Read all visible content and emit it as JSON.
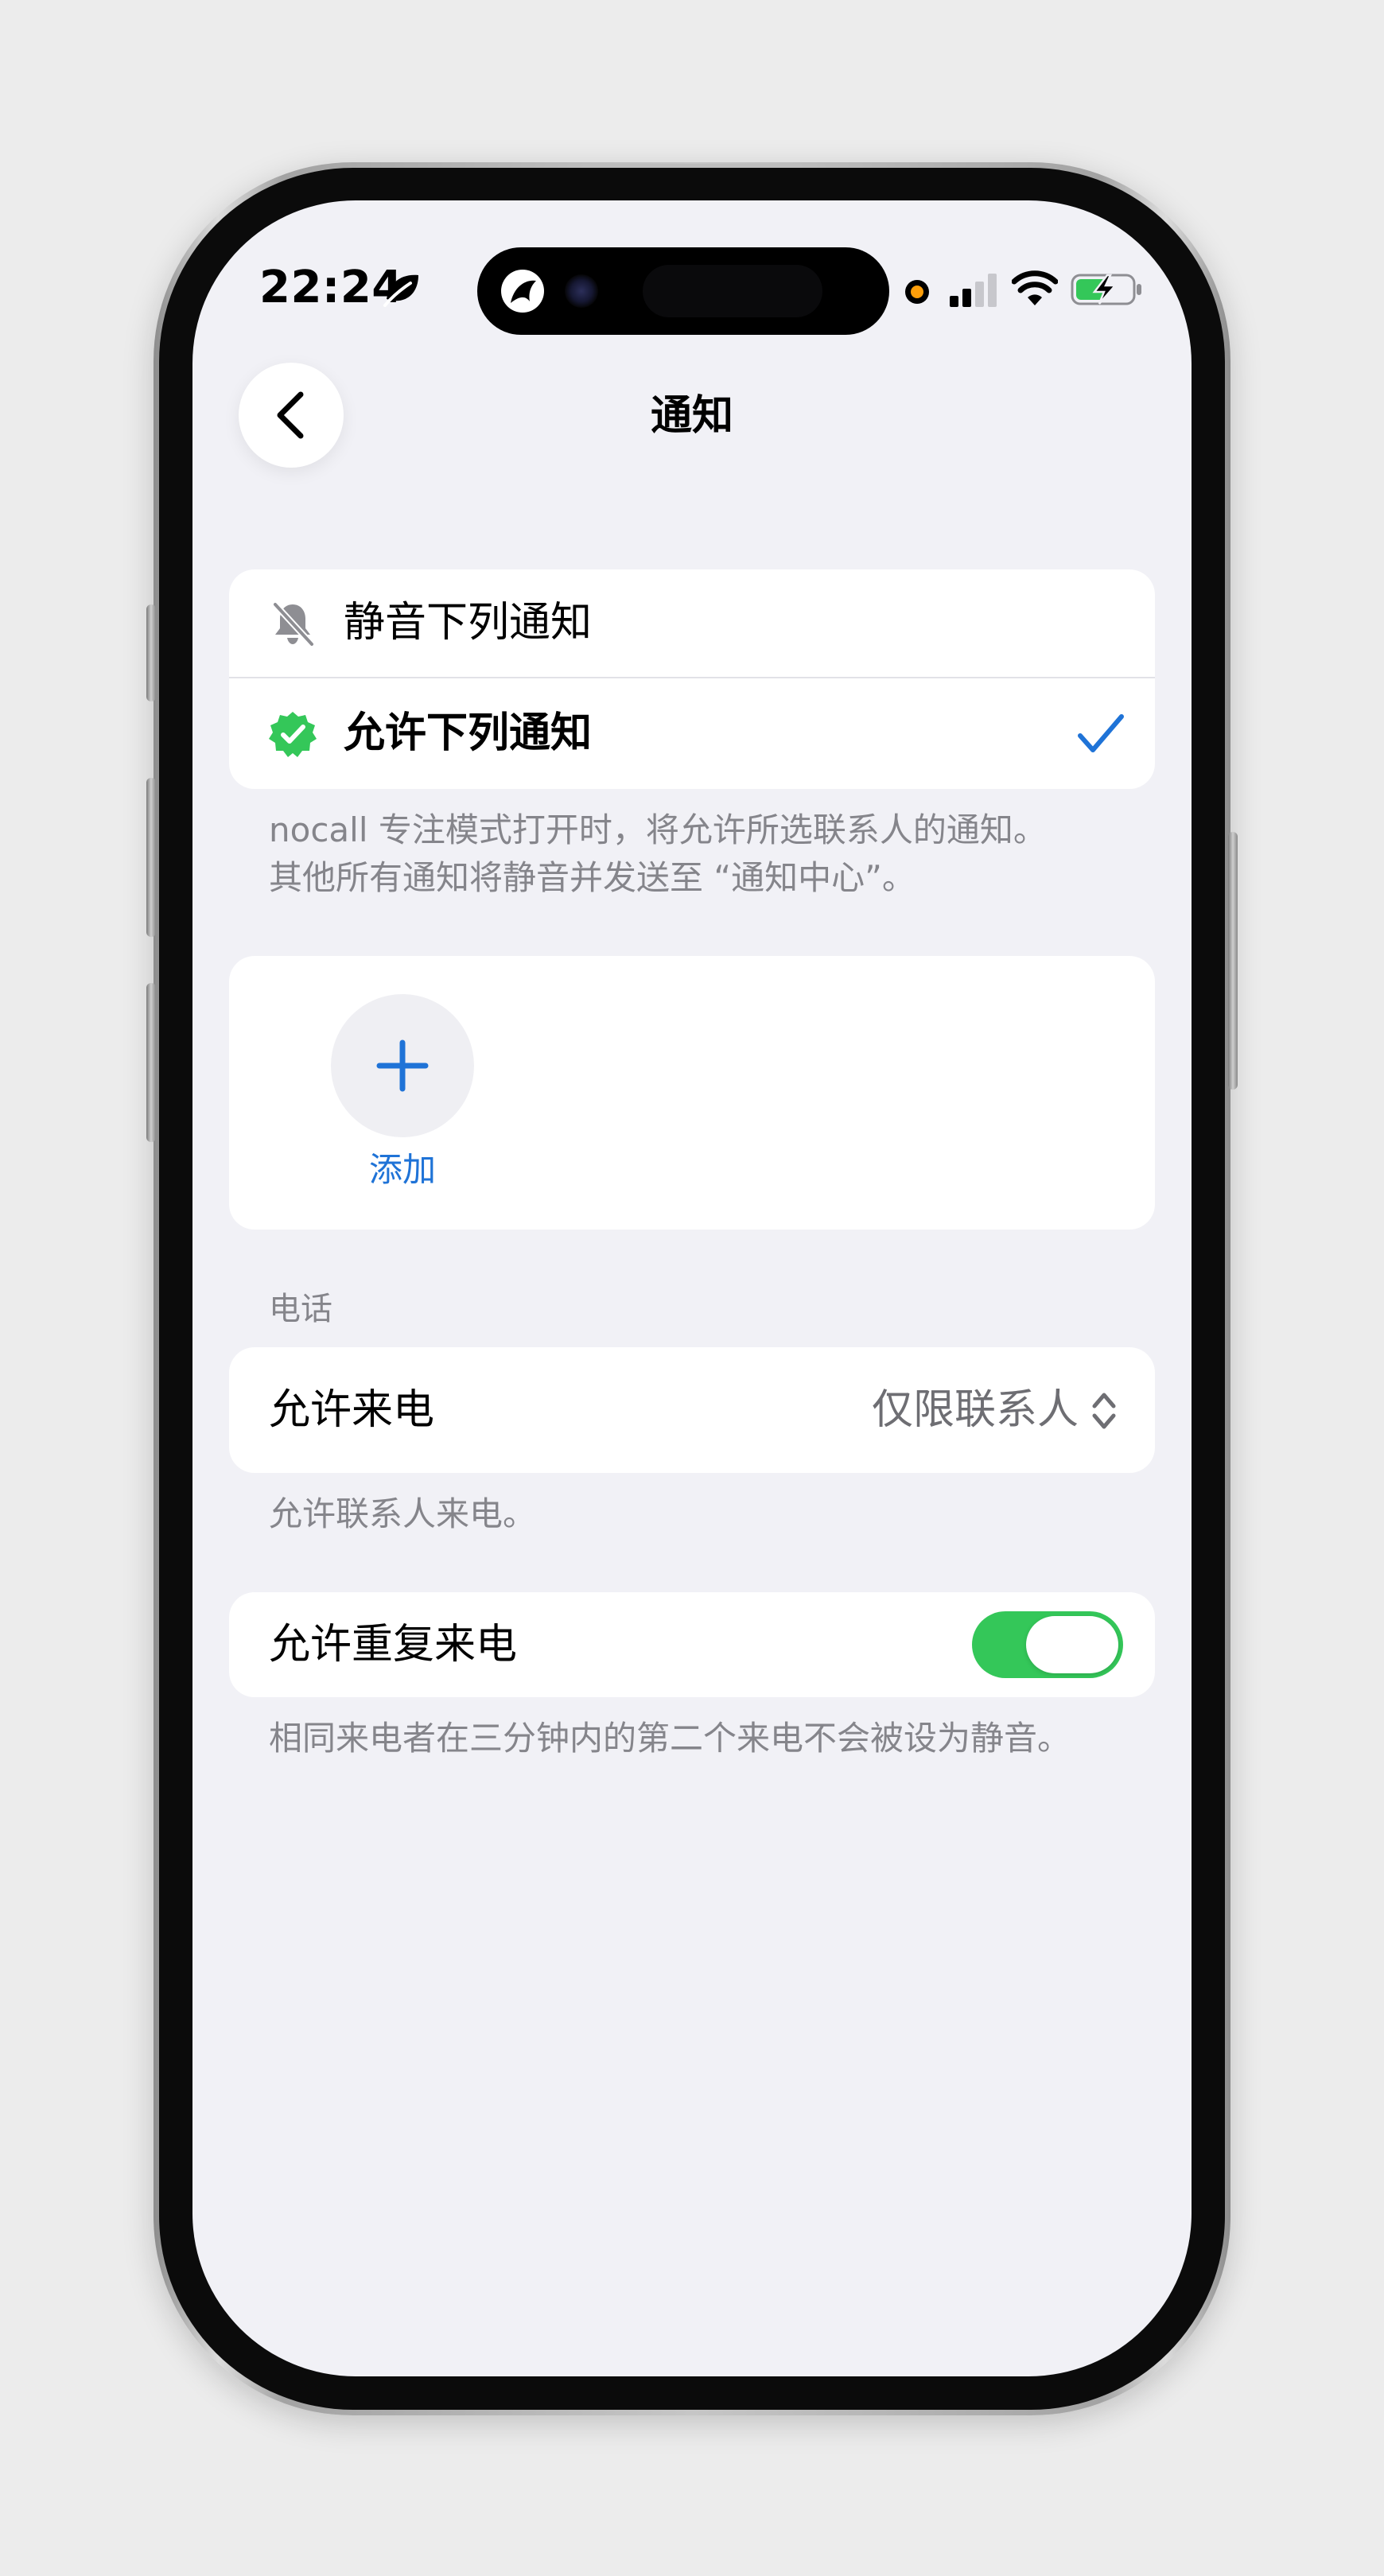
{
  "status_bar": {
    "time": "22:24"
  },
  "nav": {
    "title": "通知",
    "back_icon": "chevron-left-icon"
  },
  "notification_mode": {
    "options": [
      {
        "label": "静音下列通知",
        "icon": "bell-slash-icon",
        "selected": false
      },
      {
        "label": "允许下列通知",
        "icon": "verified-badge-icon",
        "selected": true
      }
    ],
    "footnote": [
      "nocall 专注模式打开时，将允许所选联系人的通知。",
      "其他所有通知将静音并发送至 “通知中心”。"
    ]
  },
  "people": {
    "add_label": "添加"
  },
  "calls": {
    "header": "电话",
    "allow_calls_label": "允许来电",
    "allow_calls_value": "仅限联系人",
    "allow_calls_footnote": "允许联系人来电。",
    "repeated_calls_label": "允许重复来电",
    "repeated_calls_on": true,
    "repeated_calls_footnote": "相同来电者在三分钟内的第二个来电不会被设为静音。"
  },
  "colors": {
    "accent_blue": "#1f73d7",
    "toggle_green": "#34c759",
    "badge_green": "#34c759",
    "screen_bg": "#f1f1f6",
    "secondary_text": "#85858b"
  }
}
